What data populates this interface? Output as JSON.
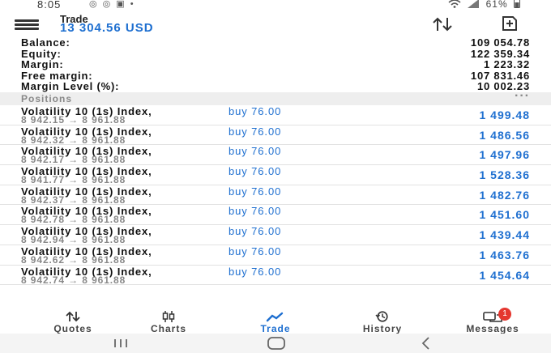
{
  "status_bar": {
    "time": "8:05",
    "left_icons": "◎ ◎ ▣ •",
    "battery": "61%"
  },
  "header": {
    "title": "Trade",
    "balance_display": "13 304.56 USD"
  },
  "summary": [
    {
      "label": "Balance:",
      "value": "109 054.78"
    },
    {
      "label": "Equity:",
      "value": "122 359.34"
    },
    {
      "label": "Margin:",
      "value": "1 223.32"
    },
    {
      "label": "Free margin:",
      "value": "107 831.46"
    },
    {
      "label": "Margin Level (%):",
      "value": "10 002.23"
    }
  ],
  "positions_header": {
    "label": "Positions",
    "more": "···"
  },
  "positions": [
    {
      "symbol": "Volatility 10 (1s) Index,",
      "side": "buy 76.00",
      "prices": "8 942.15 → 8 961.88",
      "profit": "1 499.48"
    },
    {
      "symbol": "Volatility 10 (1s) Index,",
      "side": "buy 76.00",
      "prices": "8 942.32 → 8 961.88",
      "profit": "1 486.56"
    },
    {
      "symbol": "Volatility 10 (1s) Index,",
      "side": "buy 76.00",
      "prices": "8 942.17 → 8 961.88",
      "profit": "1 497.96"
    },
    {
      "symbol": "Volatility 10 (1s) Index,",
      "side": "buy 76.00",
      "prices": "8 941.77 → 8 961.88",
      "profit": "1 528.36"
    },
    {
      "symbol": "Volatility 10 (1s) Index,",
      "side": "buy 76.00",
      "prices": "8 942.37 → 8 961.88",
      "profit": "1 482.76"
    },
    {
      "symbol": "Volatility 10 (1s) Index,",
      "side": "buy 76.00",
      "prices": "8 942.78 → 8 961.88",
      "profit": "1 451.60"
    },
    {
      "symbol": "Volatility 10 (1s) Index,",
      "side": "buy 76.00",
      "prices": "8 942.94 → 8 961.88",
      "profit": "1 439.44"
    },
    {
      "symbol": "Volatility 10 (1s) Index,",
      "side": "buy 76.00",
      "prices": "8 942.62 → 8 961.88",
      "profit": "1 463.76"
    },
    {
      "symbol": "Volatility 10 (1s) Index,",
      "side": "buy 76.00",
      "prices": "8 942.74 → 8 961.88",
      "profit": "1 454.64"
    }
  ],
  "bottom_nav": {
    "quotes": "Quotes",
    "charts": "Charts",
    "trade": "Trade",
    "history": "History",
    "messages": "Messages",
    "messages_badge": "1"
  },
  "colors": {
    "accent": "#1e6fd0",
    "badge": "#e5372f"
  },
  "icons": {
    "menu": "hamburger-menu-icon",
    "sort": "sort-arrows-icon",
    "new_order": "new-order-icon",
    "quotes": "quotes-arrows-icon",
    "charts": "candlestick-icon",
    "trade": "trend-line-icon",
    "history": "clock-history-icon",
    "messages": "chat-bubbles-icon"
  }
}
